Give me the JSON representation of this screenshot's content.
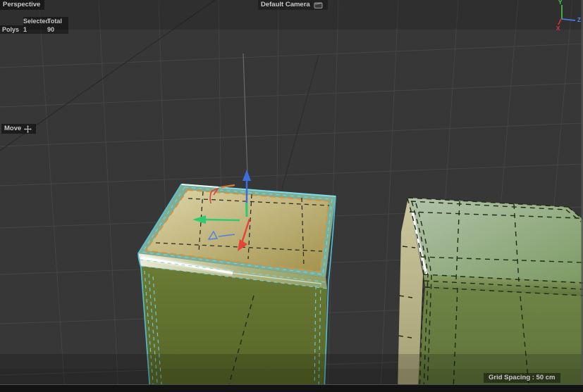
{
  "viewport": {
    "view_label": "Perspective",
    "camera": {
      "label": "Default Camera"
    },
    "stats": {
      "headers": {
        "selected": "Selected",
        "total": "Total"
      },
      "rows": [
        {
          "label": "Polys",
          "selected": "1",
          "total": "90"
        }
      ]
    },
    "tool_status": {
      "label": "Move"
    },
    "grid_status": "Grid Spacing : 50 cm",
    "axis_gizmo": {
      "y_label": "Y",
      "z_label": "Z",
      "x_label": "X"
    },
    "colors": {
      "background": "#373737",
      "selection_wireframe": "#54c6e2",
      "selected_face_border": "#e09032",
      "selected_face_fill": "#b6a863",
      "object_green": "#66772f",
      "unselected_wireframe": "#1f2a12",
      "axis_x": "#e84338",
      "axis_y": "#2ecc71",
      "axis_z": "#3b6fe0"
    }
  }
}
